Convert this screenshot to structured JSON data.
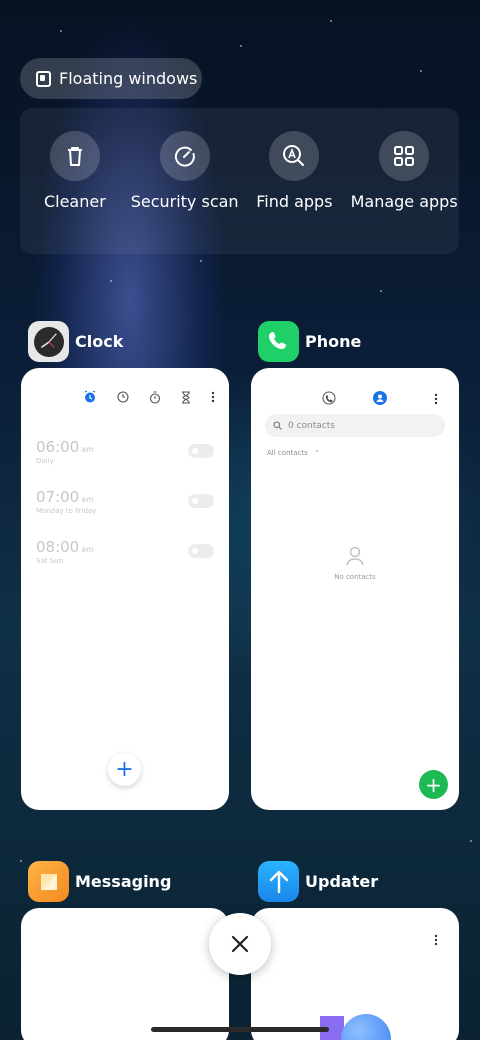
{
  "floating_windows": {
    "label": "Floating windows"
  },
  "quick_actions": [
    {
      "label": "Cleaner",
      "icon": "trash-icon"
    },
    {
      "label": "Security scan",
      "icon": "speedometer-icon"
    },
    {
      "label": "Find apps",
      "icon": "search-apps-icon"
    },
    {
      "label": "Manage apps",
      "icon": "grid-icon"
    }
  ],
  "apps": {
    "clock": {
      "name": "Clock",
      "alarms": [
        {
          "time": "06:00",
          "ampm": "am",
          "repeat": "Daily"
        },
        {
          "time": "07:00",
          "ampm": "am",
          "repeat": "Monday to Friday"
        },
        {
          "time": "08:00",
          "ampm": "am",
          "repeat": "Sat Sun"
        }
      ],
      "add_label": "+"
    },
    "phone": {
      "name": "Phone",
      "search_placeholder": "0 contacts",
      "filter_label": "All contacts",
      "empty_label": "No contacts",
      "add_label": "+"
    },
    "messaging": {
      "name": "Messaging"
    },
    "updater": {
      "name": "Updater"
    }
  },
  "colors": {
    "phone_green": "#1db954",
    "clock_accent": "#1a73e8",
    "messaging_orange": "#f7a531",
    "updater_blue": "#1e9bf0"
  }
}
